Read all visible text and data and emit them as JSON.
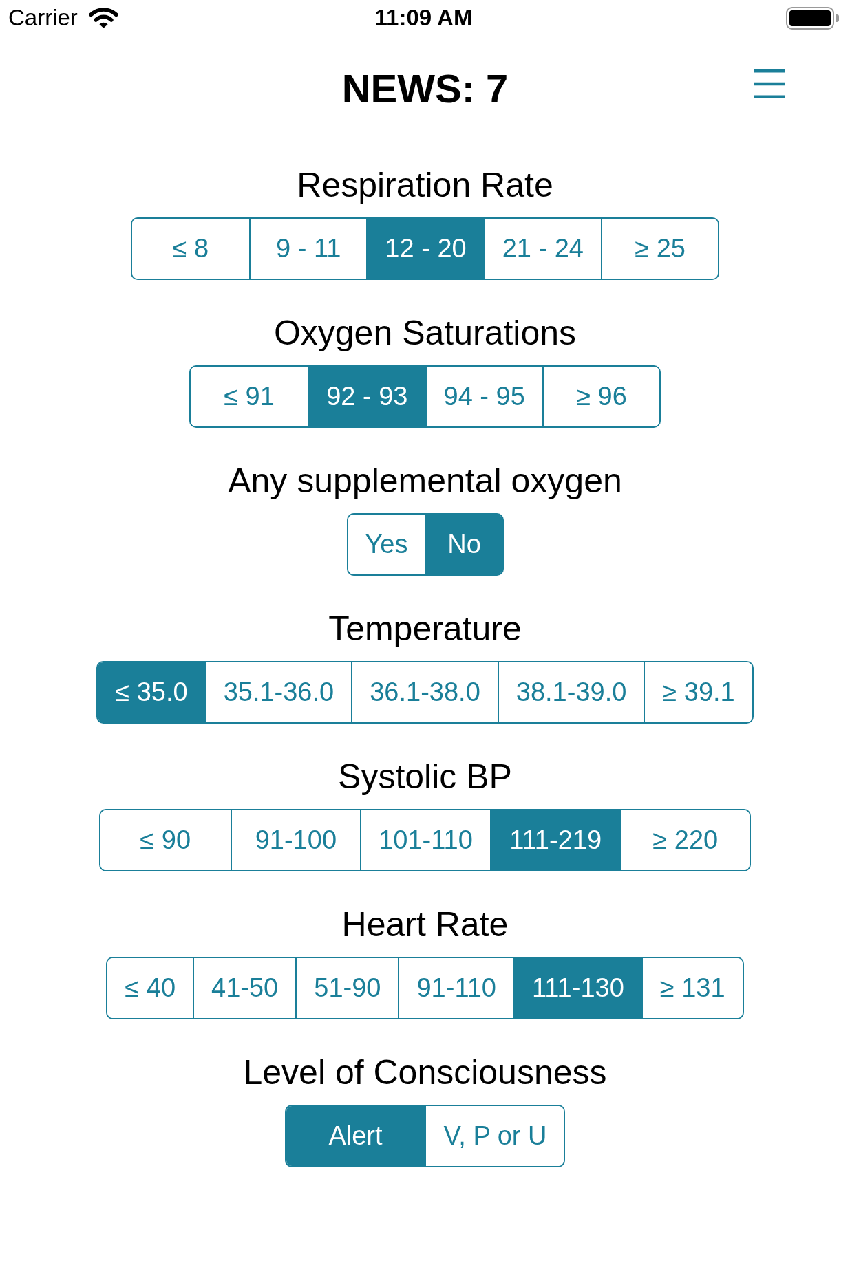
{
  "status_bar": {
    "carrier": "Carrier",
    "time": "11:09 AM"
  },
  "header": {
    "title": "NEWS: 7"
  },
  "parameters": [
    {
      "label": "Respiration Rate",
      "options": [
        {
          "label": "≤ 8",
          "selected": false
        },
        {
          "label": "9 - 11",
          "selected": false
        },
        {
          "label": "12 - 20",
          "selected": true
        },
        {
          "label": "21 - 24",
          "selected": false
        },
        {
          "label": "≥ 25",
          "selected": false
        }
      ]
    },
    {
      "label": "Oxygen Saturations",
      "options": [
        {
          "label": "≤ 91",
          "selected": false
        },
        {
          "label": "92 - 93",
          "selected": true
        },
        {
          "label": "94 - 95",
          "selected": false
        },
        {
          "label": "≥ 96",
          "selected": false
        }
      ]
    },
    {
      "label": "Any supplemental oxygen",
      "options": [
        {
          "label": "Yes",
          "selected": false
        },
        {
          "label": "No",
          "selected": true
        }
      ]
    },
    {
      "label": "Temperature",
      "options": [
        {
          "label": "≤ 35.0",
          "selected": true
        },
        {
          "label": "35.1-36.0",
          "selected": false
        },
        {
          "label": "36.1-38.0",
          "selected": false
        },
        {
          "label": "38.1-39.0",
          "selected": false
        },
        {
          "label": "≥ 39.1",
          "selected": false
        }
      ]
    },
    {
      "label": "Systolic BP",
      "options": [
        {
          "label": "≤ 90",
          "selected": false
        },
        {
          "label": "91-100",
          "selected": false
        },
        {
          "label": "101-110",
          "selected": false
        },
        {
          "label": "111-219",
          "selected": true
        },
        {
          "label": "≥ 220",
          "selected": false
        }
      ]
    },
    {
      "label": "Heart Rate",
      "options": [
        {
          "label": "≤ 40",
          "selected": false
        },
        {
          "label": "41-50",
          "selected": false
        },
        {
          "label": "51-90",
          "selected": false
        },
        {
          "label": "91-110",
          "selected": false
        },
        {
          "label": "111-130",
          "selected": true
        },
        {
          "label": "≥ 131",
          "selected": false
        }
      ]
    },
    {
      "label": "Level of Consciousness",
      "options": [
        {
          "label": "Alert",
          "selected": true
        },
        {
          "label": "V, P or U",
          "selected": false
        }
      ]
    }
  ]
}
